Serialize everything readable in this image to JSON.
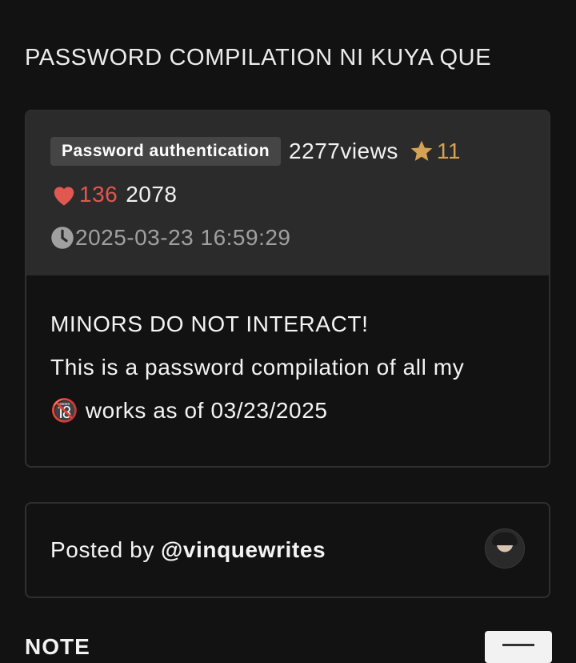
{
  "page": {
    "title": "PASSWORD COMPILATION NI KUYA QUE"
  },
  "meta": {
    "badge": "Password authentication",
    "views": "2277views",
    "stars": "11",
    "hearts": "136",
    "comments": "2078",
    "timestamp": "2025-03-23 16:59:29"
  },
  "body": {
    "line1": "MINORS DO NOT INTERACT!",
    "line2": "This is a password compilation of all my",
    "line3_rest": "works as of 03/23/2025",
    "emoji": "🔞"
  },
  "author": {
    "prefix": "Posted by",
    "username": "@vinquewrites"
  },
  "note": {
    "title": "NOTE"
  },
  "colors": {
    "background": "#121212",
    "card_head": "#2b2b2b",
    "star": "#d4a155",
    "heart": "#e0584f"
  },
  "icons": [
    "star-icon",
    "heart-icon",
    "clock-icon",
    "no-minors-icon",
    "menu-icon"
  ]
}
